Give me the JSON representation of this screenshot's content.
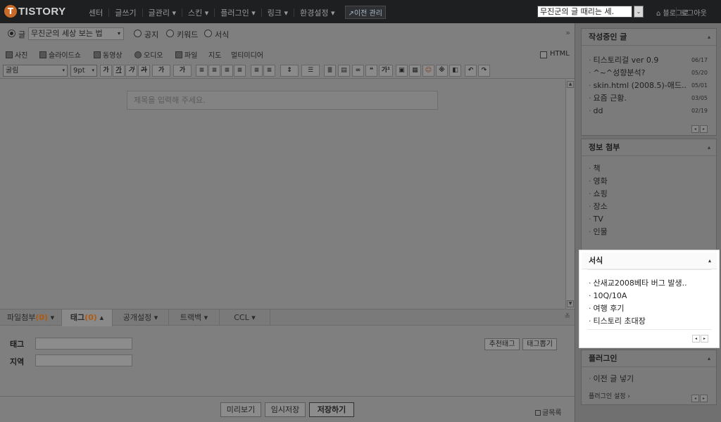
{
  "topbar": {
    "logo_mark": "T",
    "logo_text": "TISTORY",
    "nav": [
      "센터",
      "글쓰기",
      "글관리 ▾",
      "스킨 ▾",
      "플러그인 ▾",
      "링크 ▾",
      "환경설정 ▾"
    ],
    "prev_admin": "↗이전 관리",
    "post_select_value": "무진군의 글 때리는 세.",
    "post_select_btn": "⌄",
    "blog_link": "⌂ 블로그로",
    "logout": "로그아웃"
  },
  "editor": {
    "type_radio": {
      "label": "글"
    },
    "category": "무진군의 세상 보는 법",
    "type_options": [
      "공지",
      "키워드",
      "서식"
    ],
    "fold_arrow": "»",
    "media": [
      "사진",
      "슬라이드쇼",
      "동영상",
      "오디오",
      "파일",
      "지도",
      "멀티미디어"
    ],
    "html_label": "HTML",
    "font": "굴림",
    "font_size": "9pt",
    "format_btns": [
      "가",
      "가",
      "가",
      "가",
      "가",
      "가",
      "≡",
      "≡",
      "≡",
      "≡",
      "≡",
      "≡",
      "↕",
      "☰",
      "≣",
      "▤",
      "∞",
      "❝",
      "가¹",
      "▣",
      "▦",
      "☺",
      "※",
      "◧",
      "↶",
      "↷"
    ],
    "title_placeholder": "제목을 입력해 주세요.",
    "scroll_up": "▲",
    "scroll_down": "▼"
  },
  "tabs": {
    "file": {
      "label": "파일첨부",
      "count": "(0)",
      "arrow": " ▾"
    },
    "tag": {
      "label": "태그",
      "count": "(0)",
      "arrow": " ▴"
    },
    "public": "공개설정 ▾",
    "trackback": "트랙백 ▾",
    "ccl": "CCL ▾",
    "collapse": "≚"
  },
  "tagpanel": {
    "tag_label": "태그",
    "location_label": "지역",
    "recommend_btn": "추천태그",
    "view_btn": "태그뽑기"
  },
  "bottom": {
    "preview": "미리보기",
    "temp_save": "임시저장",
    "save": "저장하기",
    "list": "글목록"
  },
  "sidebar": {
    "drafts": {
      "title": "작성중인 글",
      "min": "▴",
      "items": [
        {
          "text": "티스토리걸 ver 0.9",
          "date": "06/17"
        },
        {
          "text": "^~^성향분석?",
          "date": "05/20"
        },
        {
          "text": "skin.html (2008.5)-애드..",
          "date": "05/01"
        },
        {
          "text": "요즘 근황.",
          "date": "03/05"
        },
        {
          "text": "dd",
          "date": "02/19"
        }
      ],
      "pager": [
        "◂",
        "▸"
      ]
    },
    "info": {
      "title": "정보 첨부",
      "min": "▴",
      "items": [
        "책",
        "영화",
        "쇼핑",
        "장소",
        "TV",
        "인물"
      ]
    },
    "template": {
      "title": "서식",
      "min": "▴",
      "items": [
        "산새교2008베타 버그 발생..",
        "10Q/10A",
        "여행 후기",
        "티스토리 초대장"
      ],
      "pager": [
        "◂",
        "▸"
      ]
    },
    "plugin": {
      "title": "플러그인",
      "min": "▴",
      "items": [
        "이전 글 넣기"
      ],
      "settings": "플러그인 설정 ›",
      "pager": [
        "◂",
        "▸"
      ]
    }
  }
}
